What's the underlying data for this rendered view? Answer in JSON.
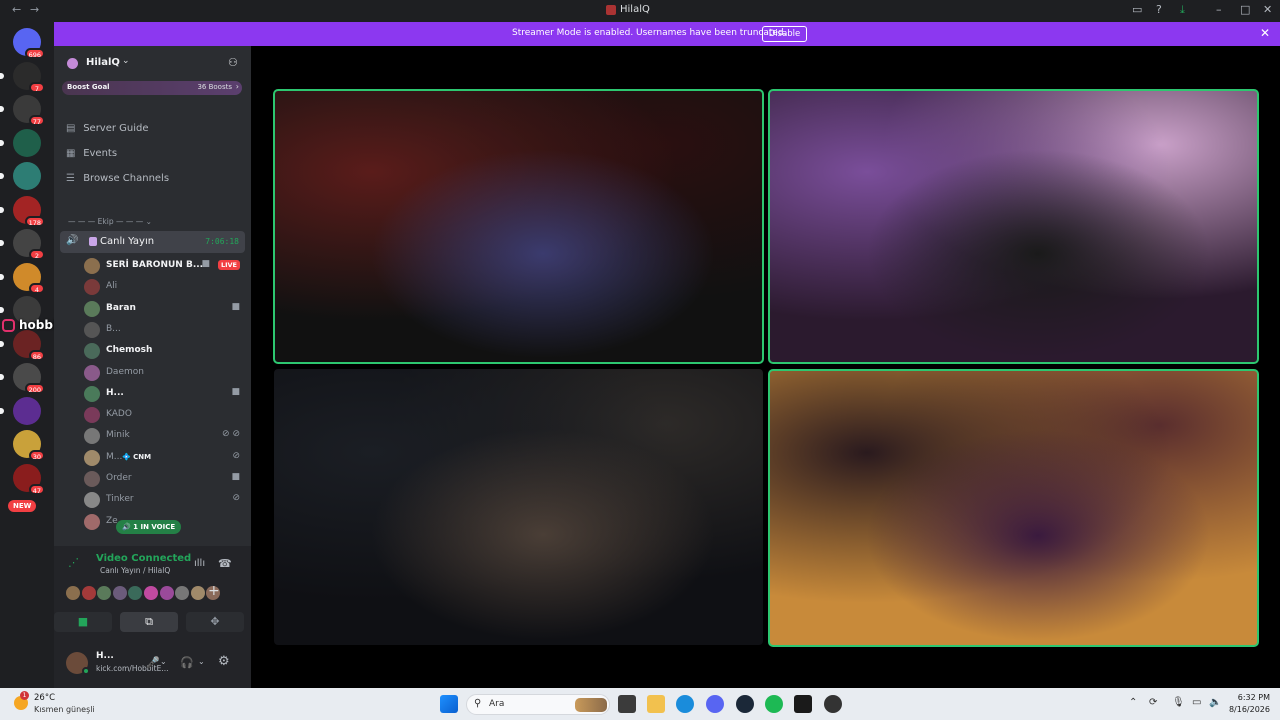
{
  "window": {
    "title": "HilalQ"
  },
  "banner": {
    "text": "Streamer Mode is enabled. Usernames have been truncated.",
    "disable_label": "Disable"
  },
  "rail": {
    "servers": [
      {
        "badge": "696",
        "color": "#5865f2"
      },
      {
        "badge": "7",
        "color": "#2b2b2b"
      },
      {
        "badge": "77",
        "color": "#3a3a3a"
      },
      {
        "badge": "",
        "color": "#1f5f4a"
      },
      {
        "badge": "",
        "color": "#2d7d74"
      },
      {
        "badge": "178",
        "color": "#a32424"
      },
      {
        "badge": "2",
        "color": "#444444"
      },
      {
        "badge": "4",
        "color": "#d08a2a"
      },
      {
        "badge": "",
        "color": "#3b3b3b"
      },
      {
        "badge": "86",
        "color": "#6b2323"
      },
      {
        "badge": "200",
        "color": "#4a4a4a"
      },
      {
        "badge": "",
        "color": "#5c2d91"
      },
      {
        "badge": "30",
        "color": "#c9a13a"
      },
      {
        "badge": "47",
        "color": "#8a1d1d"
      }
    ],
    "new_label": "NEW"
  },
  "overlay": {
    "handle": "hobbitemo"
  },
  "sidebar": {
    "server_name": "HilalQ",
    "boost_goal": "Boost Goal",
    "boost_count": "36 Boosts",
    "nav": [
      {
        "label": "Server Guide",
        "icon": "guide-icon"
      },
      {
        "label": "Events",
        "icon": "calendar-icon"
      },
      {
        "label": "Browse Channels",
        "icon": "browse-icon"
      }
    ],
    "category": "Ekip",
    "voice_channel": {
      "name": "Canlı Yayın",
      "time": "7:06:18"
    },
    "members": [
      {
        "name": "SERİ BARONUN B...",
        "bright": true,
        "live": true,
        "icon": "camera-icon"
      },
      {
        "name": "Ali",
        "bright": false
      },
      {
        "name": "Baran",
        "bright": true,
        "icon": "camera-icon"
      },
      {
        "name": "B...",
        "bright": false
      },
      {
        "name": "Chemosh",
        "bright": true
      },
      {
        "name": "Daemon",
        "bright": false
      },
      {
        "name": "H...",
        "bright": true,
        "icon": "camera-icon"
      },
      {
        "name": "KADO",
        "bright": false
      },
      {
        "name": "Minik",
        "bright": false,
        "icon": "muted-deafened-icon"
      },
      {
        "name": "M...",
        "bright": false,
        "tag": "CNM",
        "icon": "muted-icon"
      },
      {
        "name": "Order",
        "bright": false,
        "icon": "camera-icon"
      },
      {
        "name": "Tinker",
        "bright": false,
        "icon": "muted-icon"
      },
      {
        "name": "Ze...",
        "bright": false
      }
    ],
    "in_voice": "1 IN VOICE"
  },
  "voice_panel": {
    "status": "Video Connected",
    "location": "Canlı Yayın / HilalQ",
    "avatar_colors": [
      "#8b6f4e",
      "#a33a3a",
      "#5a7a5a",
      "#6b5b7b",
      "#3a6a5a",
      "#c04aa0",
      "#9a4a9a",
      "#777777",
      "#a08a6a",
      "#8a6a5a"
    ]
  },
  "user": {
    "name": "H...",
    "status": "kick.com/HobbitE..."
  },
  "video_tiles": [
    {
      "name": "tile-top-left",
      "speaking": true,
      "palette": [
        "#5a1c1a",
        "#2a0f10",
        "#111111",
        "#3b3b6e"
      ]
    },
    {
      "name": "tile-top-right",
      "speaking": true,
      "palette": [
        "#7a4e9a",
        "#c9a0c8",
        "#2b1a2e",
        "#1a1a1a"
      ]
    },
    {
      "name": "tile-bottom-left",
      "speaking": false,
      "palette": [
        "#1b1e24",
        "#2d2a28",
        "#0f1014",
        "#4a3e36"
      ]
    },
    {
      "name": "tile-bottom-right",
      "speaking": true,
      "palette": [
        "#2a1a1e",
        "#5a2e2e",
        "#c88a3a",
        "#3a1a3e"
      ]
    }
  ],
  "taskbar": {
    "temperature": "26°C",
    "condition": "Kısmen güneşli",
    "search_placeholder": "Ara",
    "time": "6:32 PM",
    "date": "8/16/2026"
  }
}
